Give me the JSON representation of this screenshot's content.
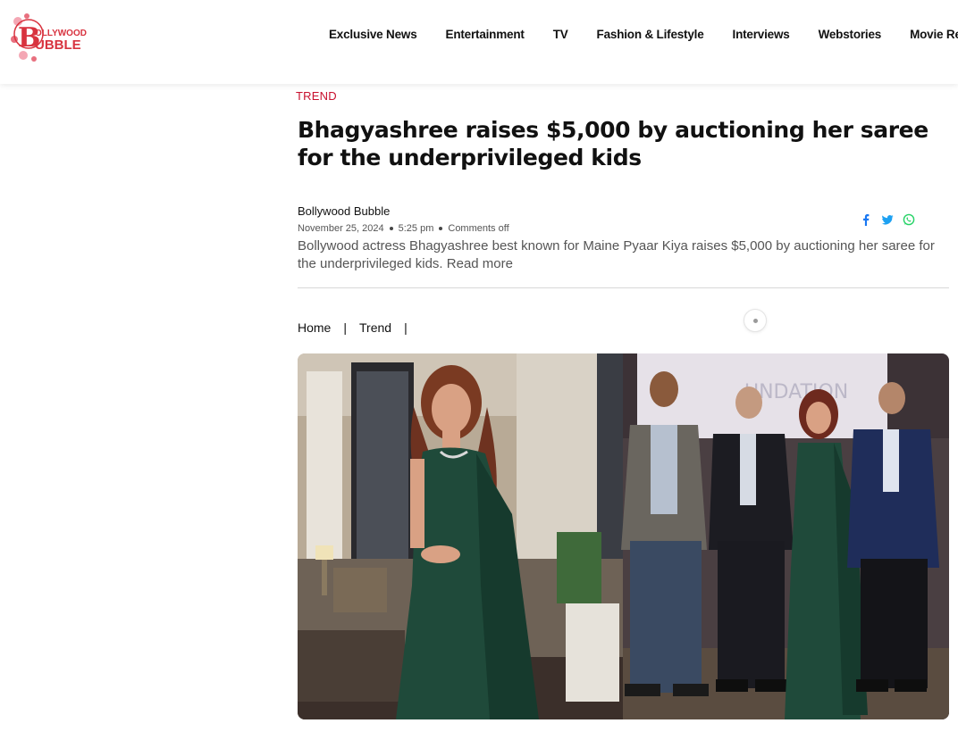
{
  "header": {
    "logo_text_top": "OLLYWOOD",
    "logo_text_bottom": "UBBLE",
    "logo_letter": "B",
    "nav": [
      "Exclusive News",
      "Entertainment",
      "TV",
      "Fashion & Lifestyle",
      "Interviews",
      "Webstories",
      "Movie Reviews"
    ]
  },
  "article": {
    "category": "TREND",
    "title": "Bhagyashree raises $5,000 by auctioning her saree for the underprivileged kids",
    "author": "Bollywood Bubble",
    "date": "November 25, 2024",
    "time": "5:25 pm",
    "comments": "Comments off",
    "excerpt": "Bollywood actress Bhagyashree best known for Maine Pyaar Kiya raises $5,000 by auctioning her saree for the underprivileged kids.",
    "read_more": "Read more"
  },
  "breadcrumb": [
    "Home",
    "Trend"
  ],
  "breadcrumb_sep": "|",
  "photo": {
    "right_banner_text": "UNDATION"
  },
  "colors": {
    "accent": "#c8102e",
    "facebook": "#1877f2",
    "twitter": "#1da1f2",
    "whatsapp": "#25d366",
    "saree": "#1f4a3a"
  },
  "icons": [
    "facebook-icon",
    "twitter-icon",
    "whatsapp-icon"
  ]
}
